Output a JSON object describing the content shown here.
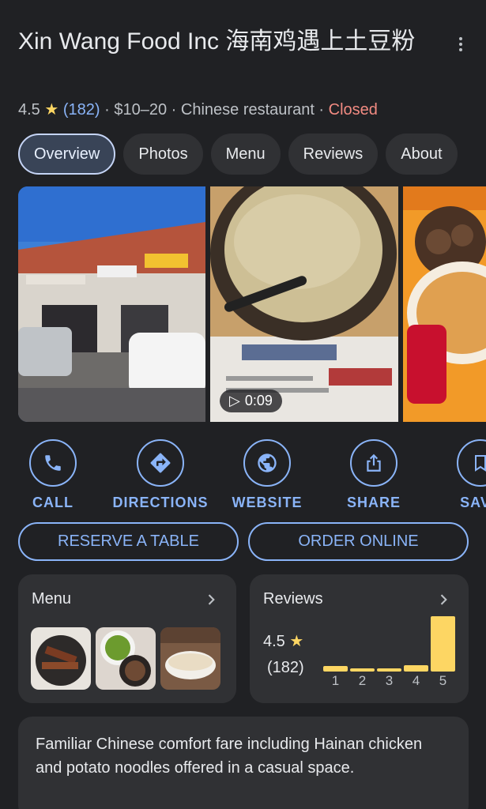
{
  "place": {
    "name": "Xin Wang Food Inc 海南鸡遇上土豆粉",
    "rating": "4.5",
    "star": "★",
    "review_count": "(182)",
    "price": "$10–20",
    "category": "Chinese restaurant",
    "status": "Closed",
    "separator": " · "
  },
  "tabs": [
    {
      "label": "Overview",
      "active": true
    },
    {
      "label": "Photos"
    },
    {
      "label": "Menu"
    },
    {
      "label": "Reviews"
    },
    {
      "label": "About"
    }
  ],
  "photos": {
    "video_duration": "0:09"
  },
  "actions": [
    {
      "label": "CALL",
      "icon": "phone-icon"
    },
    {
      "label": "DIRECTIONS",
      "icon": "directions-icon"
    },
    {
      "label": "WEBSITE",
      "icon": "globe-icon"
    },
    {
      "label": "SHARE",
      "icon": "share-icon"
    },
    {
      "label": "SAVE",
      "icon": "bookmark-icon"
    }
  ],
  "buttons": {
    "reserve": "RESERVE A TABLE",
    "order": "ORDER ONLINE"
  },
  "menu_card": {
    "title": "Menu"
  },
  "reviews_card": {
    "title": "Reviews",
    "rating": "4.5",
    "star": "★",
    "count": "(182)",
    "distribution": [
      {
        "stars": "1",
        "share": 0.1
      },
      {
        "stars": "2",
        "share": 0.05
      },
      {
        "stars": "3",
        "share": 0.05
      },
      {
        "stars": "4",
        "share": 0.12
      },
      {
        "stars": "5",
        "share": 1.0
      }
    ]
  },
  "description": "Familiar Chinese comfort fare including Hainan chicken and potato noodles offered in a casual space.",
  "colors": {
    "background": "#202124",
    "card": "#303134",
    "accent": "#8ab4f8",
    "star": "#fdd663",
    "closed": "#f28b82"
  }
}
